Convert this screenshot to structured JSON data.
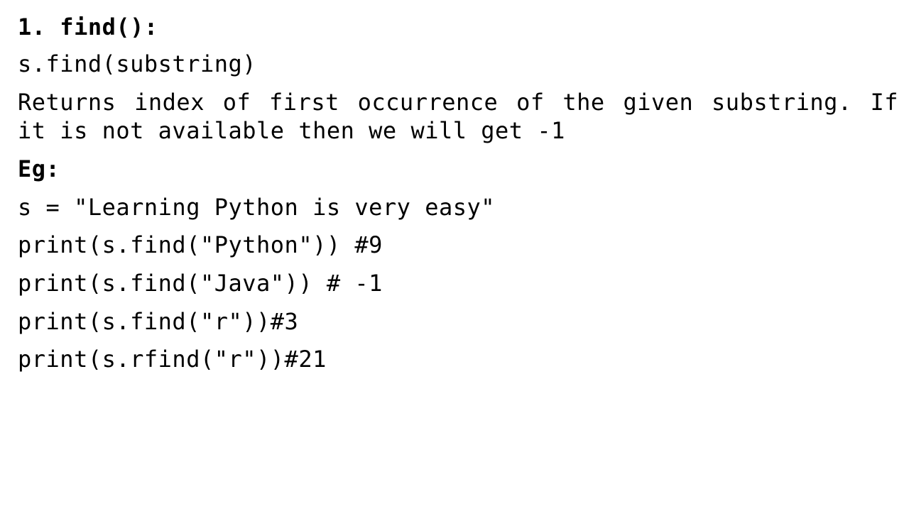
{
  "slide": {
    "heading": "1. find():",
    "syntax": "s.find(substring)",
    "description": "Returns index of first occurrence of the given substring. If it is not available then we will get -1",
    "example_label": "Eg:",
    "code_lines": [
      "s = \"Learning Python is very easy\"",
      "print(s.find(\"Python\")) #9",
      "print(s.find(\"Java\")) # -1",
      "print(s.find(\"r\"))#3",
      "print(s.rfind(\"r\"))#21"
    ]
  }
}
